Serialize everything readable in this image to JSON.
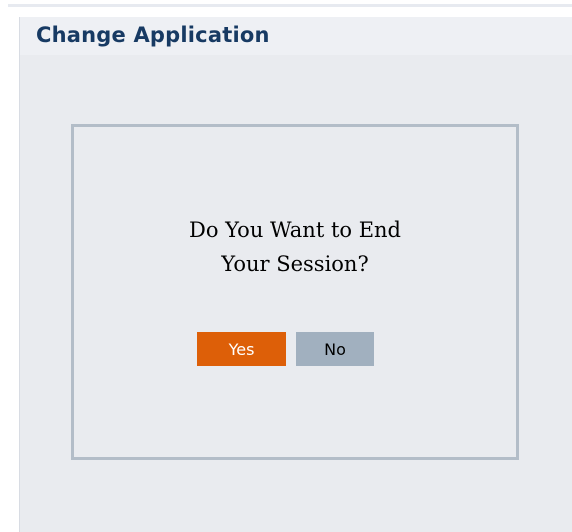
{
  "panel": {
    "title": "Change Application"
  },
  "dialog": {
    "prompt_line1": "Do You Want to End",
    "prompt_line2": "Your Session?",
    "yes_label": "Yes",
    "no_label": "No"
  },
  "colors": {
    "title": "#173a63",
    "panel_background": "#e9ebef",
    "dialog_border": "#b3bdc8",
    "yes_button": "#dd5f08",
    "no_button": "#a1b0bf"
  }
}
